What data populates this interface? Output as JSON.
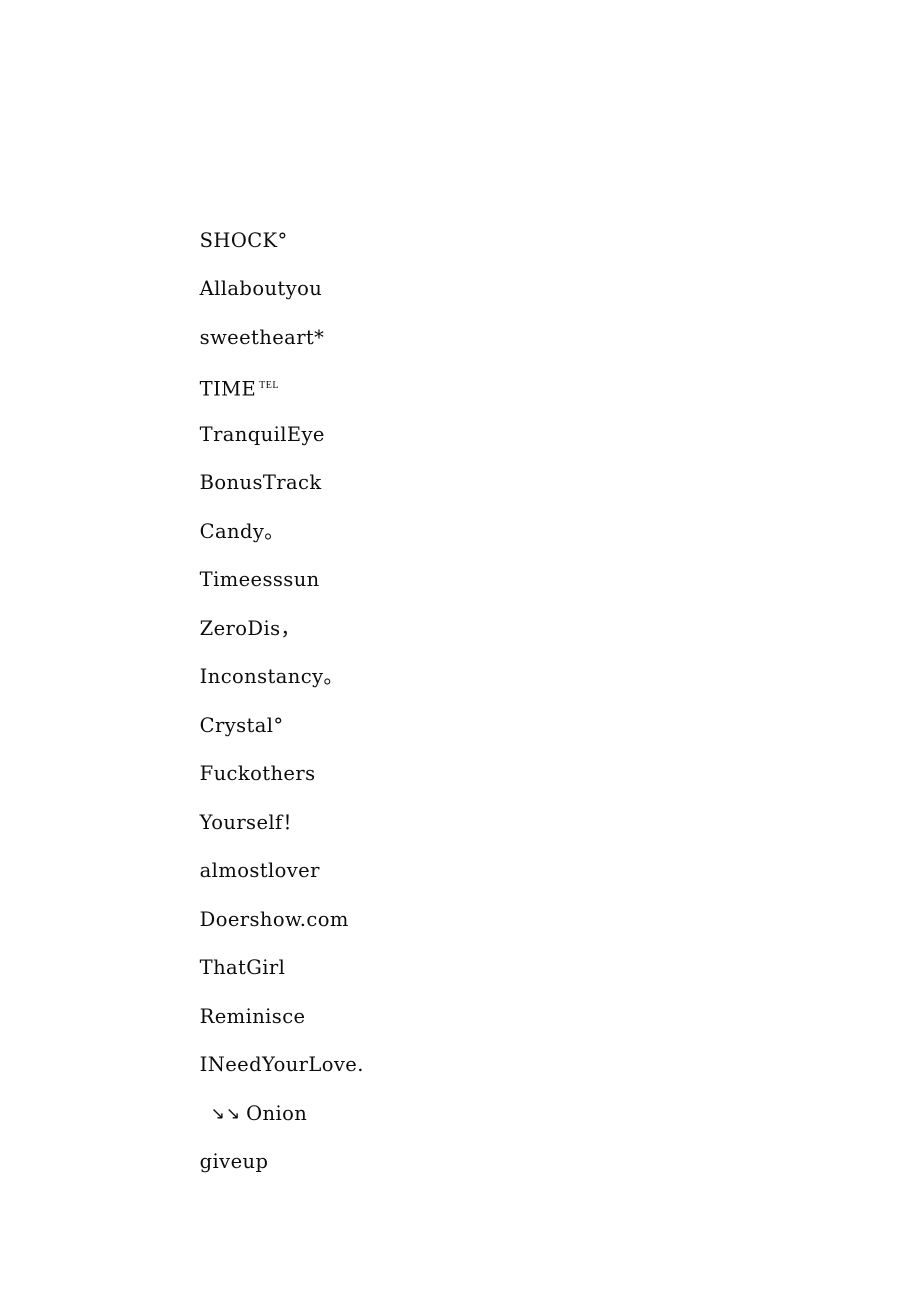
{
  "document": {
    "background_color": "#ffffff",
    "text_color": "#0c0c0c",
    "lines": [
      {
        "id": "line-1",
        "text": "SHOCK°"
      },
      {
        "id": "line-2",
        "text": "Allaboutyou"
      },
      {
        "id": "line-3",
        "text": "sweetheart*"
      },
      {
        "id": "line-4",
        "text": "TIME",
        "superscript": "TEL"
      },
      {
        "id": "line-5",
        "text": "TranquilEye"
      },
      {
        "id": "line-6",
        "text": "BonusTrack"
      },
      {
        "id": "line-7",
        "text": "Candy。"
      },
      {
        "id": "line-8",
        "text": "Timeesssun"
      },
      {
        "id": "line-9",
        "text": "ZeroDis，"
      },
      {
        "id": "line-10",
        "text": "Inconstancy。"
      },
      {
        "id": "line-11",
        "text": "Crystal°"
      },
      {
        "id": "line-12",
        "text": "Fuckothers"
      },
      {
        "id": "line-13",
        "text": "Yourself！"
      },
      {
        "id": "line-14",
        "text": "almostlover"
      },
      {
        "id": "line-15",
        "text": "Doershow.com"
      },
      {
        "id": "line-16",
        "text": "ThatGirl"
      },
      {
        "id": "line-17",
        "text": "Reminisce"
      },
      {
        "id": "line-18",
        "text": "INeedYourLove."
      },
      {
        "id": "line-19",
        "text": "Onion",
        "leading_glyph": "↘↘",
        "indented": true
      },
      {
        "id": "line-20",
        "text": "giveup"
      }
    ]
  }
}
